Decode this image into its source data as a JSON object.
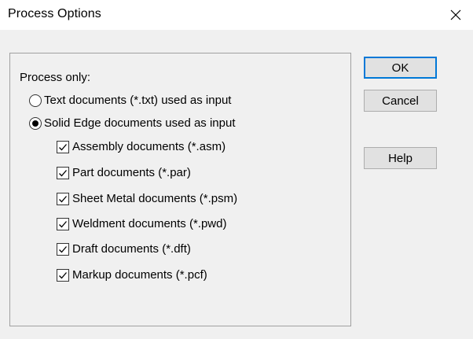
{
  "window": {
    "title": "Process Options",
    "close_icon": "close-icon"
  },
  "group": {
    "label": "Process only:",
    "radios": [
      {
        "label": "Text documents (*.txt) used as input",
        "selected": false
      },
      {
        "label": "Solid Edge documents used as input",
        "selected": true
      }
    ],
    "checkboxes": [
      {
        "label": "Assembly documents (*.asm)",
        "checked": true
      },
      {
        "label": "Part documents (*.par)",
        "checked": true
      },
      {
        "label": "Sheet Metal documents (*.psm)",
        "checked": true
      },
      {
        "label": "Weldment documents (*.pwd)",
        "checked": true
      },
      {
        "label": "Draft documents (*.dft)",
        "checked": true
      },
      {
        "label": "Markup documents (*.pcf)",
        "checked": true
      }
    ]
  },
  "buttons": {
    "ok": "OK",
    "cancel": "Cancel",
    "help": "Help"
  },
  "colors": {
    "accent": "#0078d7",
    "window_bg": "#f0f0f0",
    "titlebar_bg": "#ffffff"
  }
}
